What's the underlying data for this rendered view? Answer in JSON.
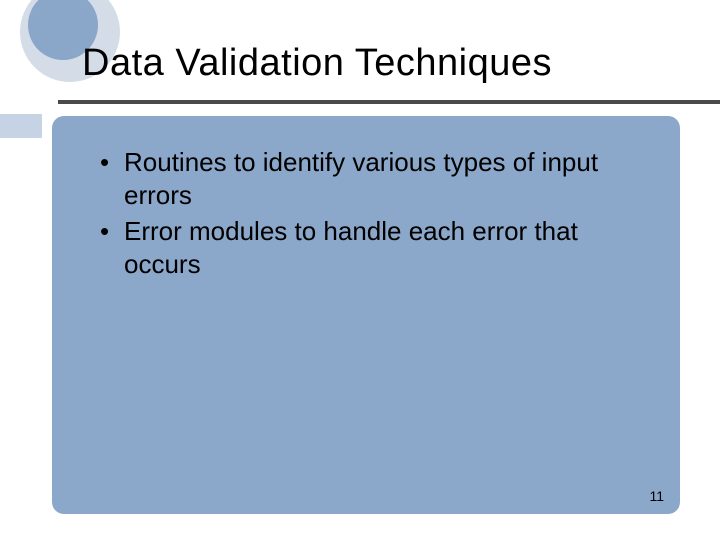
{
  "title": "Data Validation Techniques",
  "bullets": [
    "Routines to identify various types of input errors",
    "Error modules to handle each error that occurs"
  ],
  "page_number": "11",
  "colors": {
    "panel": "#8ba7c9",
    "circle_outer": "#d4dce8",
    "circle_inner": "#8aa6c8",
    "side_block": "#c6d3e4",
    "hr": "#4a4a4a"
  }
}
